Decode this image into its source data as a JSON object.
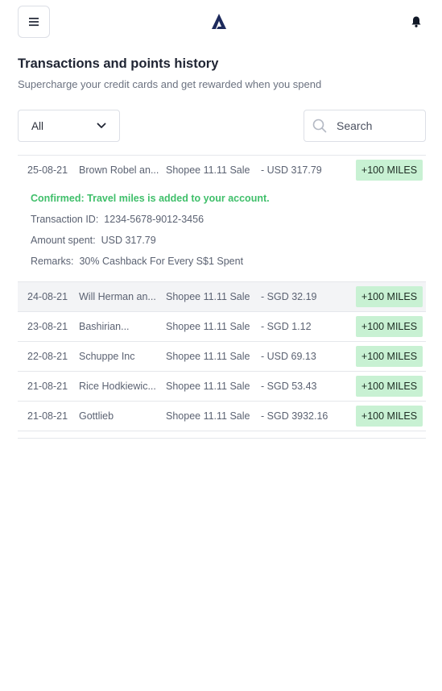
{
  "header": {
    "menu_icon": "hamburger-icon",
    "logo_icon": "brand-logo-icon",
    "bell_icon": "bell-icon"
  },
  "page": {
    "title": "Transactions and points history",
    "subtitle": "Supercharge your credit cards and get rewarded when you spend"
  },
  "filters": {
    "selected": "All",
    "search_placeholder": "Search"
  },
  "expanded": {
    "date": "25-08-21",
    "merchant": "Brown Robel an...",
    "campaign": "Shopee 11.11 Sale",
    "amount": "- USD 317.79",
    "badge": "+100 MILES",
    "confirm_text": "Confirmed: Travel miles is added to your account.",
    "transaction_id_label": "Transaction ID:",
    "transaction_id": "1234-5678-9012-3456",
    "amount_spent_label": "Amount spent:",
    "amount_spent": "USD 317.79",
    "remarks_label": "Remarks:",
    "remarks": "30% Cashback For Every S$1 Spent"
  },
  "rows": [
    {
      "date": "24-08-21",
      "merchant": "Will Herman an...",
      "campaign": "Shopee 11.11 Sale",
      "amount": "- SGD 32.19",
      "badge": "+100 MILES"
    },
    {
      "date": "23-08-21",
      "merchant": "Bashirian...",
      "campaign": "Shopee 11.11 Sale",
      "amount": "- SGD 1.12",
      "badge": "+100 MILES"
    },
    {
      "date": "22-08-21",
      "merchant": "Schuppe Inc",
      "campaign": "Shopee 11.11 Sale",
      "amount": "- USD 69.13",
      "badge": "+100 MILES"
    },
    {
      "date": "21-08-21",
      "merchant": "Rice Hodkiewic...",
      "campaign": "Shopee 11.11 Sale",
      "amount": "- SGD 53.43",
      "badge": "+100 MILES"
    },
    {
      "date": "21-08-21",
      "merchant": "Gottlieb",
      "campaign": "Shopee 11.11 Sale",
      "amount": "- SGD 3932.16",
      "badge": "+100 MILES"
    }
  ],
  "colors": {
    "badge_bg": "#c8f1d3",
    "confirm_green": "#3fbf6a",
    "brand_navy": "#1d2a5c"
  }
}
